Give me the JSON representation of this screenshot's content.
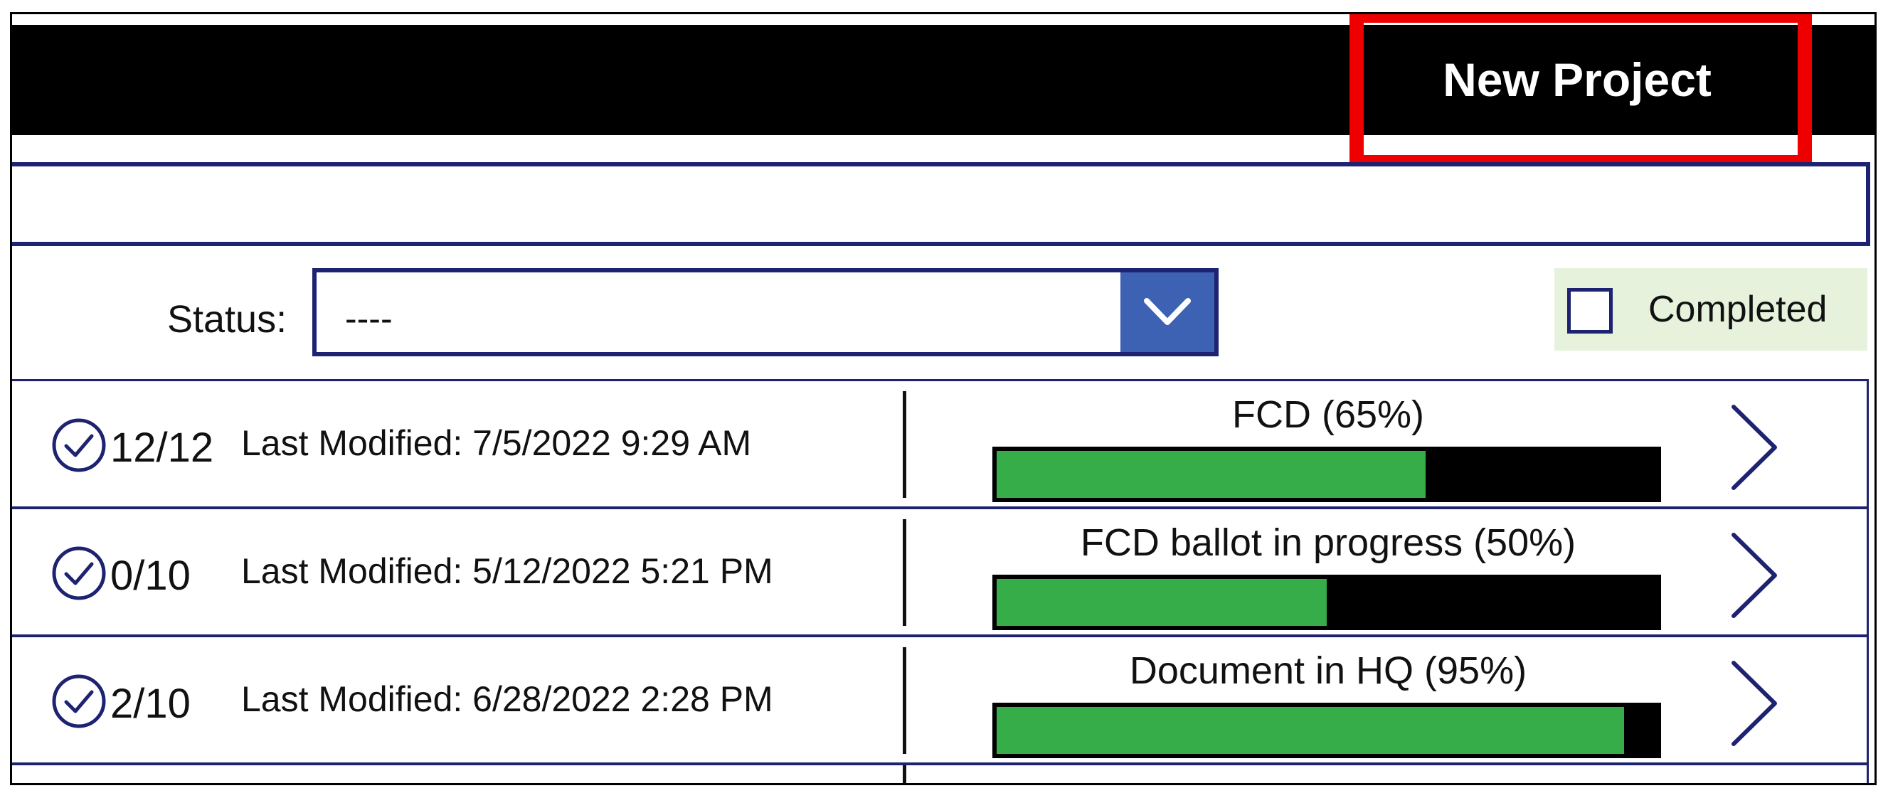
{
  "header": {
    "new_project_label": "New Project"
  },
  "search": {
    "value": "",
    "placeholder": ""
  },
  "filters": {
    "status_label": "Status:",
    "status_value": "----",
    "completed_label": "Completed",
    "completed_checked": false
  },
  "projects": [
    {
      "count": "12/12",
      "modified": "Last Modified: 7/5/2022 9:29 AM",
      "status": "FCD (65%)",
      "progress_percent": 65
    },
    {
      "count": "0/10",
      "modified": "Last Modified: 5/12/2022 5:21 PM",
      "status": "FCD ballot in progress (50%)",
      "progress_percent": 50
    },
    {
      "count": "2/10",
      "modified": "Last Modified: 6/28/2022 2:28 PM",
      "status": "Document in HQ (95%)",
      "progress_percent": 95
    }
  ],
  "icons": {
    "row_status": "check-circle-icon",
    "row_action": "chevron-right-icon",
    "dropdown": "chevron-down-icon"
  },
  "colors": {
    "header_bg": "#000000",
    "highlight": "#ee0000",
    "accent_border": "#1d2370",
    "dropdown_button": "#3d62b3",
    "progress_fill": "#37ad4a",
    "progress_track": "#000000",
    "completed_bg": "#e6f2dc"
  }
}
